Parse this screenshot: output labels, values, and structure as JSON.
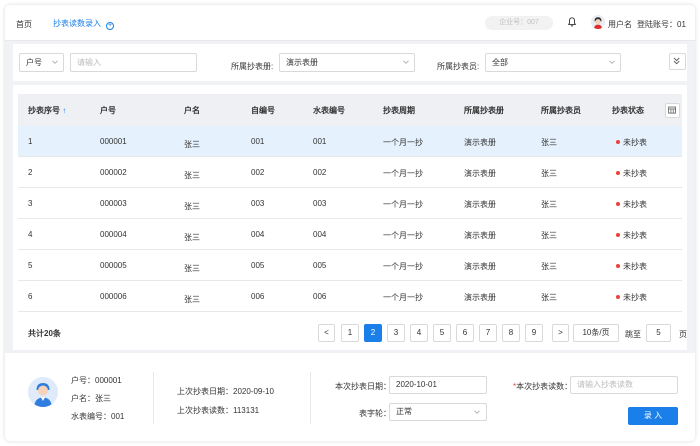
{
  "topbar": {
    "home": "首页",
    "tab_label": "抄表读数录入",
    "tab_add_symbol": "+",
    "tenant": "企业号：007",
    "user_name": "用户名",
    "account": "登陆账号：01"
  },
  "filter": {
    "field_select": "户号",
    "search_placeholder": "请输入",
    "book_label": "所属抄表册:",
    "book_value": "演示表册",
    "reader_label": "所属抄表员:",
    "reader_value": "全部"
  },
  "table": {
    "columns": [
      "抄表序号",
      "户号",
      "户名",
      "自编号",
      "水表编号",
      "抄表周期",
      "所属抄表册",
      "所属抄表员",
      "抄表状态"
    ],
    "sort_indicator": "↑",
    "rows": [
      {
        "seq": "1",
        "account": "000001",
        "name": "张三",
        "selfno": "001",
        "meter": "001",
        "cycle": "一个月一抄",
        "book": "演示表册",
        "reader": "张三",
        "status": "未抄表"
      },
      {
        "seq": "2",
        "account": "000002",
        "name": "张三",
        "selfno": "002",
        "meter": "002",
        "cycle": "一个月一抄",
        "book": "演示表册",
        "reader": "张三",
        "status": "未抄表"
      },
      {
        "seq": "3",
        "account": "000003",
        "name": "张三",
        "selfno": "003",
        "meter": "003",
        "cycle": "一个月一抄",
        "book": "演示表册",
        "reader": "张三",
        "status": "未抄表"
      },
      {
        "seq": "4",
        "account": "000004",
        "name": "张三",
        "selfno": "004",
        "meter": "004",
        "cycle": "一个月一抄",
        "book": "演示表册",
        "reader": "张三",
        "status": "未抄表"
      },
      {
        "seq": "5",
        "account": "000005",
        "name": "张三",
        "selfno": "005",
        "meter": "005",
        "cycle": "一个月一抄",
        "book": "演示表册",
        "reader": "张三",
        "status": "未抄表"
      },
      {
        "seq": "6",
        "account": "000006",
        "name": "张三",
        "selfno": "006",
        "meter": "006",
        "cycle": "一个月一抄",
        "book": "演示表册",
        "reader": "张三",
        "status": "未抄表"
      }
    ],
    "total": "共计20条"
  },
  "pagination": {
    "prev": "<",
    "pages": [
      "1",
      "2",
      "3",
      "4",
      "5",
      "6",
      "7",
      "8",
      "9"
    ],
    "current": "2",
    "next": ">",
    "page_size": "10条/页",
    "jump_label": "跳至",
    "jump_value": "5",
    "page_unit": "页"
  },
  "footer": {
    "account": "户号：000001",
    "name": "户名：张三",
    "meter": "水表编号：001",
    "last_date": "上次抄表日期：2020-09-10",
    "last_reading": "上次抄表读数：113131",
    "this_date_label": "本次抄表日期：",
    "this_date_value": "2020-10-01",
    "dial_label": "表字轮：",
    "dial_value": "正常",
    "reading_required": "*",
    "reading_label": "本次抄表读数：",
    "reading_placeholder": "请输入抄表读数",
    "submit": "录 入"
  },
  "colors": {
    "accent": "#1a7fe8",
    "selected_row": "#e5f1fc",
    "status_dot": "#e8423b"
  }
}
